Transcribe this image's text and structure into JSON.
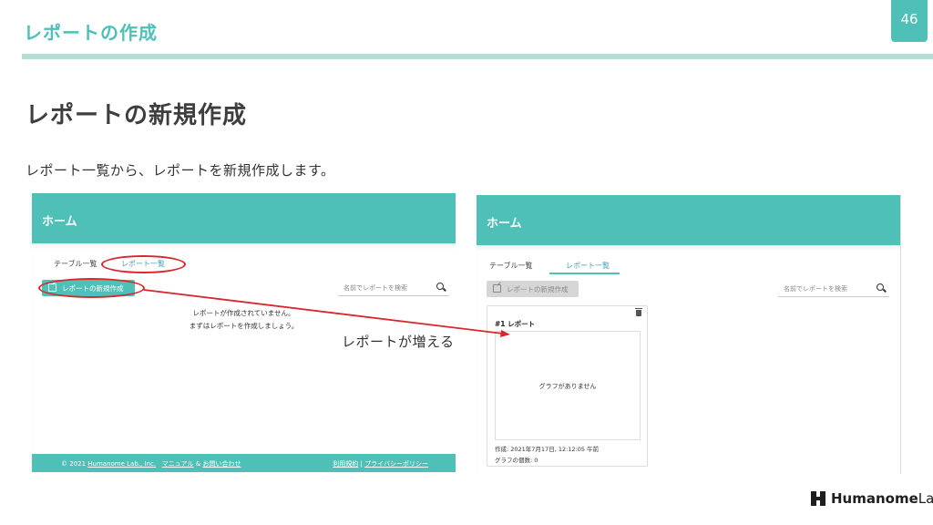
{
  "slide": {
    "title": "レポートの作成",
    "page_number": "46",
    "heading": "レポートの新規作成",
    "description": "レポート一覧から、レポートを新規作成します。",
    "callout": "レポートが増える"
  },
  "app": {
    "header_title": "ホーム",
    "tabs": [
      "テーブル一覧",
      "レポート一覧"
    ],
    "new_report_button": "レポートの新規作成",
    "search_placeholder": "名前でレポートを検索"
  },
  "left_screen": {
    "empty_line1": "レポートが作成されていません。",
    "empty_line2": "まずはレポートを作成しましょう。",
    "footer": {
      "copyright_prefix": "© 2021",
      "company_link": "Humanome Lab., Inc.",
      "manual_link": "マニュアル",
      "separator": "&",
      "contact_link": "お問い合わせ",
      "terms_link": "利用規約",
      "divider": "|",
      "privacy_link": "プライバシーポリシー"
    }
  },
  "right_screen": {
    "report_card": {
      "title": "#1 レポート",
      "empty_graph": "グラフがありません",
      "created": "作成: 2021年7月17日, 12:12:05 午前",
      "graph_count": "グラフの個数: 0"
    }
  },
  "logo": {
    "name_bold": "Humanome",
    "name_light": "Lab"
  },
  "colors": {
    "accent": "#4ec0b7",
    "highlight": "#d9272e",
    "rule": "#b6dcd7"
  }
}
